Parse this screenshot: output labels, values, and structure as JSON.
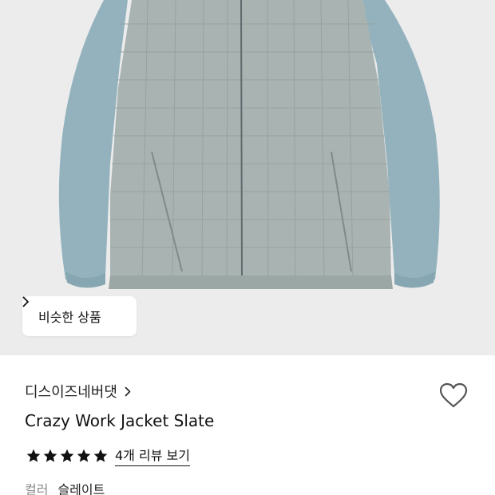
{
  "similar_button": {
    "label": "비슷한 상품",
    "icon": "chevron-right-icon"
  },
  "brand": {
    "name": "디스이즈네버댓",
    "icon": "chevron-right-icon"
  },
  "wishlist": {
    "icon": "heart-outline-icon"
  },
  "product": {
    "name": "Crazy Work Jacket Slate"
  },
  "rating": {
    "stars": 5,
    "max": 5,
    "reviews_link": "4개 리뷰 보기"
  },
  "color_option": {
    "label": "컬러",
    "value": "슬레이트"
  },
  "colors": {
    "background": "#ececec",
    "sleeve": "#93b2bd",
    "body": "#a9b4b2"
  }
}
